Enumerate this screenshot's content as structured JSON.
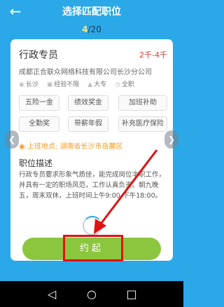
{
  "header": {
    "back_icon": "back-arrow-icon",
    "title": "选择匹配职位",
    "pager_current": "4",
    "pager_total": "/20"
  },
  "card": {
    "job_title": "行政专员",
    "salary": "2千-4千",
    "company": "成都正合联众网络科技有限公司长沙分公司",
    "meta": {
      "city": "长沙",
      "experience": "经验不限",
      "education": "大专",
      "job_type": "全职"
    },
    "tags": [
      "五险一金",
      "绩效奖金",
      "加班补助",
      "全勤奖",
      "带薪年假",
      "补充医疗保险"
    ],
    "location_label": "上班地点:",
    "location_value": "湖南省长沙市岳麓区",
    "section_title": "职位描述",
    "description": "行政专员要求形象气质佳，能完成岗位本职工作，并具有一定的职场风范，工作认真负责。朝九晚五，周末双休，上班时间上午9:00-下午18:00。"
  },
  "action": {
    "button_label": "约起"
  },
  "colors": {
    "background": "#2aa8e8",
    "button": "#8cc63f",
    "salary": "#e53935",
    "highlight": "#e01111",
    "location": "#f29b1f"
  }
}
